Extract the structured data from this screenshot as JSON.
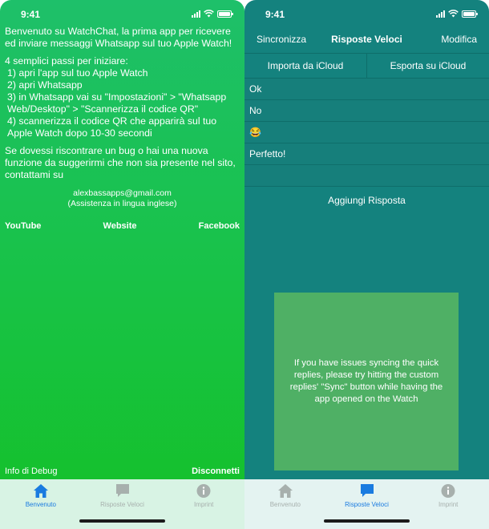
{
  "status": {
    "time": "9:41"
  },
  "left": {
    "intro": "Benvenuto su WatchChat, la prima app per ricevere ed inviare messaggi Whatsapp sul tuo Apple Watch!",
    "steps_title": "4 semplici passi per iniziare:",
    "steps": [
      "1) apri l'app sul tuo Apple Watch",
      "2) apri Whatsapp",
      "3) in Whatsapp vai su \"Impostazioni\" > \"Whatsapp Web/Desktop\" > \"Scannerizza il codice QR\"",
      "4) scannerizza il codice QR che apparirà sul tuo Apple Watch dopo 10-30 secondi"
    ],
    "bug_text": "Se dovessi riscontrare un bug o hai una nuova funzione da suggerirmi che non sia presente nel sito, contattami su",
    "email": "alexbassapps@gmail.com",
    "support_note": "(Assistenza in lingua inglese)",
    "links": {
      "youtube": "YouTube",
      "website": "Website",
      "facebook": "Facebook"
    },
    "debug": "Info di Debug",
    "disconnect": "Disconnetti"
  },
  "right": {
    "nav": {
      "left": "Sincronizza",
      "title": "Risposte Veloci",
      "right": "Modifica"
    },
    "import": "Importa da iCloud",
    "export": "Esporta su iCloud",
    "replies": [
      "Ok",
      "No",
      "😂",
      "Perfetto!"
    ],
    "add_reply": "Aggiungi Risposta",
    "notice": "If you have issues syncing the quick replies, please try hitting the custom replies' \"Sync\" button while having the app opened on the Watch"
  },
  "tabs": [
    {
      "label": "Benvenuto",
      "icon": "house-icon"
    },
    {
      "label": "Risposte Veloci",
      "icon": "chat-bubble-icon"
    },
    {
      "label": "Imprint",
      "icon": "info-icon"
    }
  ],
  "colors": {
    "active_tab": "#1a7be0",
    "inactive_tab": "#a7b0ad",
    "teal_background": "#14827e",
    "notice_background": "#4fb065",
    "green_gradient_top": "#1ec06a",
    "green_gradient_bottom": "#14c128"
  }
}
